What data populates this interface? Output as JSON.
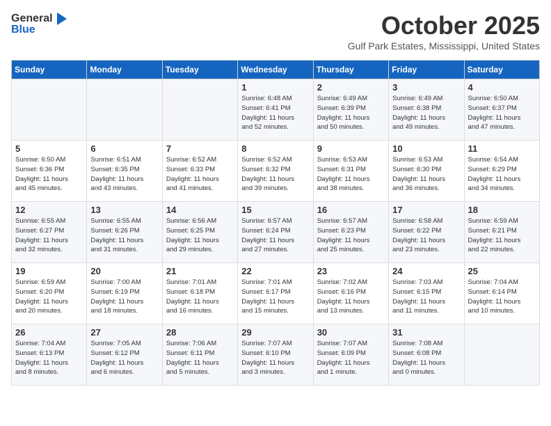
{
  "header": {
    "logo_general": "General",
    "logo_blue": "Blue",
    "month_title": "October 2025",
    "location": "Gulf Park Estates, Mississippi, United States"
  },
  "days_of_week": [
    "Sunday",
    "Monday",
    "Tuesday",
    "Wednesday",
    "Thursday",
    "Friday",
    "Saturday"
  ],
  "weeks": [
    [
      {
        "day": "",
        "info": ""
      },
      {
        "day": "",
        "info": ""
      },
      {
        "day": "",
        "info": ""
      },
      {
        "day": "1",
        "info": "Sunrise: 6:48 AM\nSunset: 6:41 PM\nDaylight: 11 hours\nand 52 minutes."
      },
      {
        "day": "2",
        "info": "Sunrise: 6:49 AM\nSunset: 6:39 PM\nDaylight: 11 hours\nand 50 minutes."
      },
      {
        "day": "3",
        "info": "Sunrise: 6:49 AM\nSunset: 6:38 PM\nDaylight: 11 hours\nand 49 minutes."
      },
      {
        "day": "4",
        "info": "Sunrise: 6:50 AM\nSunset: 6:37 PM\nDaylight: 11 hours\nand 47 minutes."
      }
    ],
    [
      {
        "day": "5",
        "info": "Sunrise: 6:50 AM\nSunset: 6:36 PM\nDaylight: 11 hours\nand 45 minutes."
      },
      {
        "day": "6",
        "info": "Sunrise: 6:51 AM\nSunset: 6:35 PM\nDaylight: 11 hours\nand 43 minutes."
      },
      {
        "day": "7",
        "info": "Sunrise: 6:52 AM\nSunset: 6:33 PM\nDaylight: 11 hours\nand 41 minutes."
      },
      {
        "day": "8",
        "info": "Sunrise: 6:52 AM\nSunset: 6:32 PM\nDaylight: 11 hours\nand 39 minutes."
      },
      {
        "day": "9",
        "info": "Sunrise: 6:53 AM\nSunset: 6:31 PM\nDaylight: 11 hours\nand 38 minutes."
      },
      {
        "day": "10",
        "info": "Sunrise: 6:53 AM\nSunset: 6:30 PM\nDaylight: 11 hours\nand 36 minutes."
      },
      {
        "day": "11",
        "info": "Sunrise: 6:54 AM\nSunset: 6:29 PM\nDaylight: 11 hours\nand 34 minutes."
      }
    ],
    [
      {
        "day": "12",
        "info": "Sunrise: 6:55 AM\nSunset: 6:27 PM\nDaylight: 11 hours\nand 32 minutes."
      },
      {
        "day": "13",
        "info": "Sunrise: 6:55 AM\nSunset: 6:26 PM\nDaylight: 11 hours\nand 31 minutes."
      },
      {
        "day": "14",
        "info": "Sunrise: 6:56 AM\nSunset: 6:25 PM\nDaylight: 11 hours\nand 29 minutes."
      },
      {
        "day": "15",
        "info": "Sunrise: 6:57 AM\nSunset: 6:24 PM\nDaylight: 11 hours\nand 27 minutes."
      },
      {
        "day": "16",
        "info": "Sunrise: 6:57 AM\nSunset: 6:23 PM\nDaylight: 11 hours\nand 25 minutes."
      },
      {
        "day": "17",
        "info": "Sunrise: 6:58 AM\nSunset: 6:22 PM\nDaylight: 11 hours\nand 23 minutes."
      },
      {
        "day": "18",
        "info": "Sunrise: 6:59 AM\nSunset: 6:21 PM\nDaylight: 11 hours\nand 22 minutes."
      }
    ],
    [
      {
        "day": "19",
        "info": "Sunrise: 6:59 AM\nSunset: 6:20 PM\nDaylight: 11 hours\nand 20 minutes."
      },
      {
        "day": "20",
        "info": "Sunrise: 7:00 AM\nSunset: 6:19 PM\nDaylight: 11 hours\nand 18 minutes."
      },
      {
        "day": "21",
        "info": "Sunrise: 7:01 AM\nSunset: 6:18 PM\nDaylight: 11 hours\nand 16 minutes."
      },
      {
        "day": "22",
        "info": "Sunrise: 7:01 AM\nSunset: 6:17 PM\nDaylight: 11 hours\nand 15 minutes."
      },
      {
        "day": "23",
        "info": "Sunrise: 7:02 AM\nSunset: 6:16 PM\nDaylight: 11 hours\nand 13 minutes."
      },
      {
        "day": "24",
        "info": "Sunrise: 7:03 AM\nSunset: 6:15 PM\nDaylight: 11 hours\nand 11 minutes."
      },
      {
        "day": "25",
        "info": "Sunrise: 7:04 AM\nSunset: 6:14 PM\nDaylight: 11 hours\nand 10 minutes."
      }
    ],
    [
      {
        "day": "26",
        "info": "Sunrise: 7:04 AM\nSunset: 6:13 PM\nDaylight: 11 hours\nand 8 minutes."
      },
      {
        "day": "27",
        "info": "Sunrise: 7:05 AM\nSunset: 6:12 PM\nDaylight: 11 hours\nand 6 minutes."
      },
      {
        "day": "28",
        "info": "Sunrise: 7:06 AM\nSunset: 6:11 PM\nDaylight: 11 hours\nand 5 minutes."
      },
      {
        "day": "29",
        "info": "Sunrise: 7:07 AM\nSunset: 6:10 PM\nDaylight: 11 hours\nand 3 minutes."
      },
      {
        "day": "30",
        "info": "Sunrise: 7:07 AM\nSunset: 6:09 PM\nDaylight: 11 hours\nand 1 minute."
      },
      {
        "day": "31",
        "info": "Sunrise: 7:08 AM\nSunset: 6:08 PM\nDaylight: 11 hours\nand 0 minutes."
      },
      {
        "day": "",
        "info": ""
      }
    ]
  ]
}
